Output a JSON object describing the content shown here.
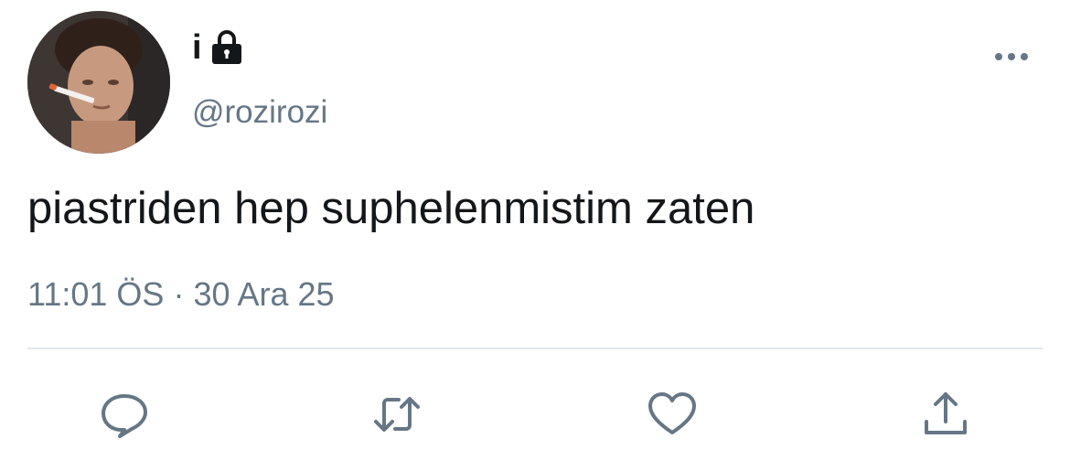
{
  "tweet": {
    "display_name": "i",
    "handle": "@rozirozi",
    "text": "piastriden hep suphelenmistim zaten",
    "time": "11:01 ÖS",
    "separator": "·",
    "date": "30 Ara 25"
  },
  "icons": {
    "lock": "lock-icon",
    "more": "more-icon",
    "reply": "reply-icon",
    "retweet": "retweet-icon",
    "like": "heart-icon",
    "share": "share-icon"
  },
  "colors": {
    "text": "#14171a",
    "secondary": "#657786",
    "divider": "#e1e8ed",
    "icon": "#657786"
  }
}
